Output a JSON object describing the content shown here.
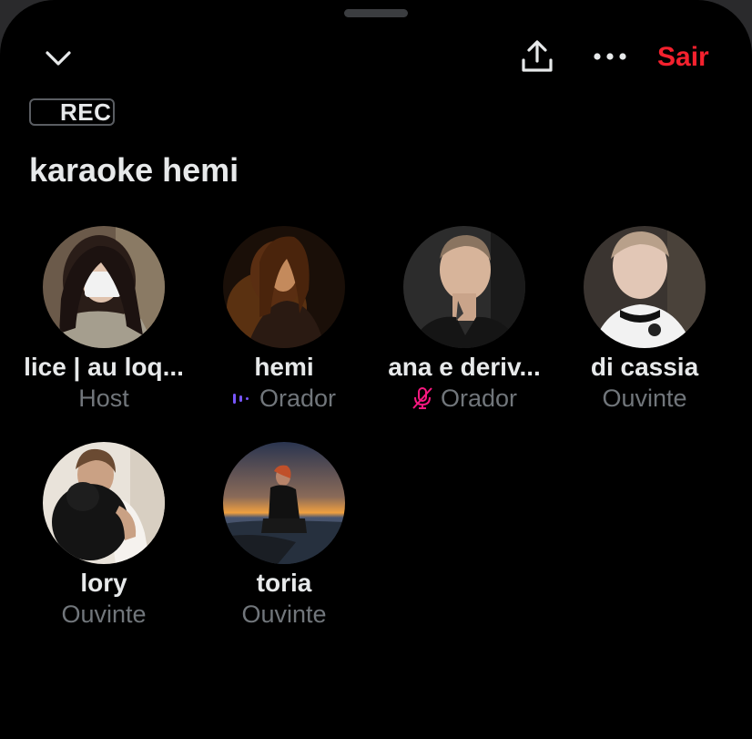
{
  "header": {
    "leave_label": "Sair",
    "icons": [
      "chevron-down-icon",
      "share-icon",
      "more-icon"
    ]
  },
  "recording_badge": {
    "label": "REC"
  },
  "space": {
    "title": "karaoke hemi"
  },
  "participants": [
    {
      "name": "lice | au loq...",
      "role": "Host",
      "status": "none"
    },
    {
      "name": "hemi",
      "role": "Orador",
      "status": "speaking"
    },
    {
      "name": "ana e deriv...",
      "role": "Orador",
      "status": "muted"
    },
    {
      "name": "di cassia",
      "role": "Ouvinte",
      "status": "none"
    },
    {
      "name": "lory",
      "role": "Ouvinte",
      "status": "none"
    },
    {
      "name": "toria",
      "role": "Ouvinte",
      "status": "none"
    }
  ],
  "colors": {
    "background": "#000000",
    "accent_leave": "#f4212e",
    "speaking_indicator": "#7856ff",
    "muted_indicator": "#f91880",
    "secondary_text": "#71767b",
    "primary_text": "#e7e9ea"
  }
}
